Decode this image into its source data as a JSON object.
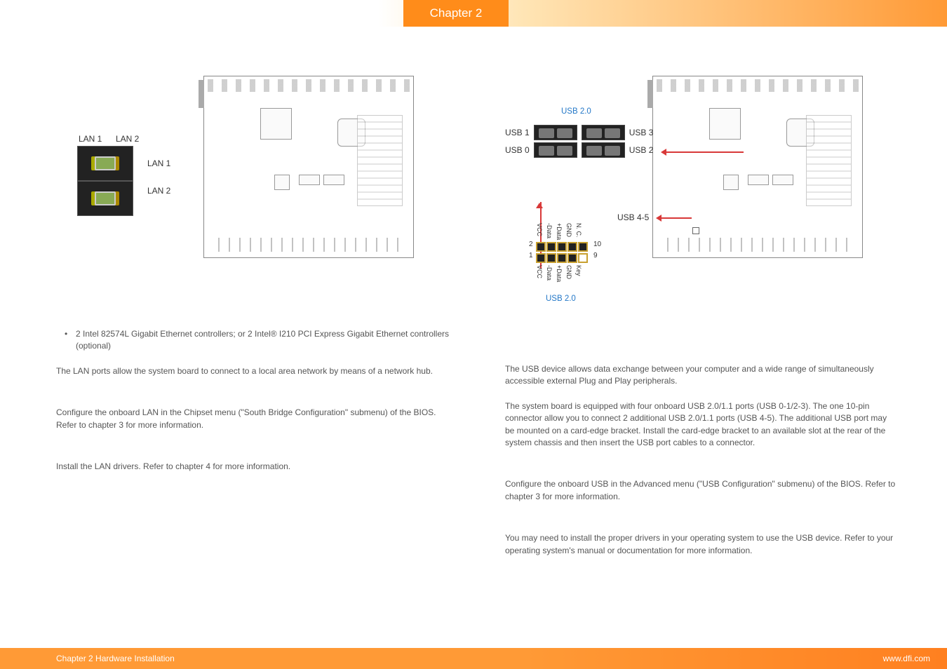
{
  "chapter_tab": "Chapter 2",
  "left": {
    "lan1": "LAN 1",
    "lan2": "LAN 2",
    "lan1_ptr": "LAN 1",
    "lan2_ptr": "LAN 2",
    "bullet": "2 Intel 82574L Gigabit Ethernet controllers; or 2 Intel® I210 PCI Express Gigabit Ethernet controllers (optional)",
    "para1": "The LAN ports allow the system board to connect to a local area network by means of a network hub.",
    "para2": "Configure the onboard LAN in the Chipset menu (\"South Bridge Configuration\" submenu) of the BIOS. Refer to chapter 3 for more information.",
    "para3": "Install the LAN drivers. Refer to chapter 4 for more information."
  },
  "right": {
    "usb20_a": "USB 2.0",
    "usb20_b": "USB 2.0",
    "usb1": "USB 1",
    "usb0": "USB 0",
    "usb3": "USB 3",
    "usb2": "USB 2",
    "usb45": "USB 4-5",
    "pins_top": [
      "N. C.",
      "GND",
      "+Data",
      "-Data",
      "VCC"
    ],
    "pins_bot": [
      "Key",
      "GND",
      "+Data",
      "-Data",
      "VCC"
    ],
    "pin2": "2",
    "pin1": "1",
    "pin10": "10",
    "pin9": "9",
    "para1": "The USB device allows data exchange between your computer and a wide range of simultaneously accessible external Plug and Play peripherals.",
    "para2": "The system board is equipped with four onboard USB 2.0/1.1 ports (USB 0-1/2-3). The one 10-pin connector allow you to connect 2 additional USB 2.0/1.1 ports (USB 4-5). The additional USB port may be mounted on a card-edge bracket. Install the card-edge bracket to an available slot at the rear of the system chassis and then insert the USB port cables to a connector.",
    "para3": "Configure the onboard USB in the Advanced menu (\"USB Configuration\" submenu) of the BIOS. Refer to chapter 3 for more information.",
    "para4": "You may need to install the proper drivers in your operating system to use the USB device. Refer to your operating system's manual or documentation for more information."
  },
  "footer": {
    "left": "Chapter 2 Hardware Installation",
    "right": "www.dfi.com"
  }
}
